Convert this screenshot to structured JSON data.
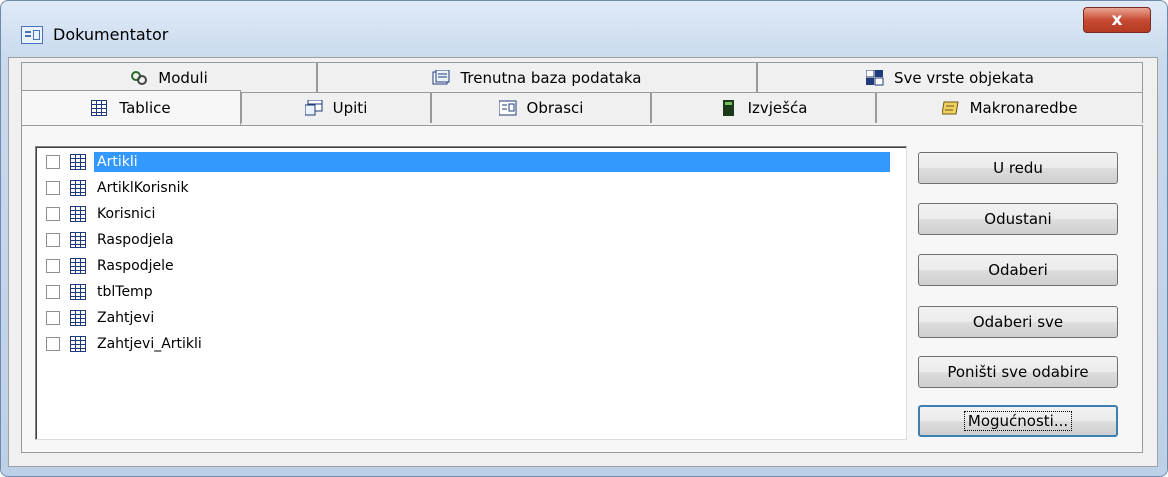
{
  "window": {
    "title": "Dokumentator",
    "close_label": "x"
  },
  "tabs_row1": [
    {
      "label": "Moduli",
      "icon": "modules-icon"
    },
    {
      "label": "Trenutna baza podataka",
      "icon": "database-icon"
    },
    {
      "label": "Sve vrste objekata",
      "icon": "all-objects-icon"
    }
  ],
  "tabs_row2": [
    {
      "label": "Tablice",
      "icon": "table-icon",
      "active": true
    },
    {
      "label": "Upiti",
      "icon": "query-icon"
    },
    {
      "label": "Obrasci",
      "icon": "form-icon"
    },
    {
      "label": "Izvješća",
      "icon": "report-icon"
    },
    {
      "label": "Makronaredbe",
      "icon": "macro-icon"
    }
  ],
  "tables": [
    {
      "label": "Artikli",
      "checked": false,
      "selected": true
    },
    {
      "label": "ArtiklKorisnik",
      "checked": false
    },
    {
      "label": "Korisnici",
      "checked": false
    },
    {
      "label": "Raspodjela",
      "checked": false
    },
    {
      "label": "Raspodjele",
      "checked": false
    },
    {
      "label": "tblTemp",
      "checked": false
    },
    {
      "label": "Zahtjevi",
      "checked": false
    },
    {
      "label": "Zahtjevi_Artikli",
      "checked": false
    }
  ],
  "buttons": {
    "ok": "U redu",
    "cancel": "Odustani",
    "select": "Odaberi",
    "select_all": "Odaberi sve",
    "deselect_all": "Poništi sve odabire",
    "options": "Mogućnosti..."
  },
  "colors": {
    "selection": "#3399ff",
    "close": "#c74b32",
    "icon_blue": "#1f3a7a"
  }
}
